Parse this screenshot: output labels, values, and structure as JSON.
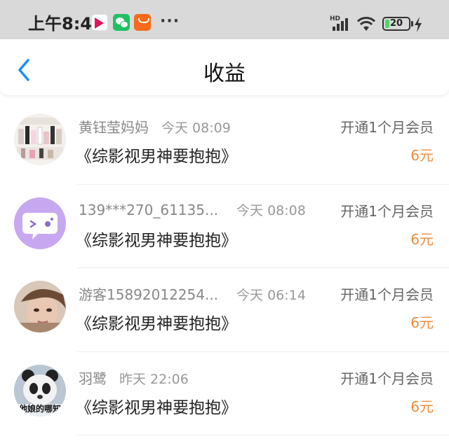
{
  "status_bar": {
    "time": "上午8:44",
    "more": "···",
    "network_label": "HD",
    "battery_percent": "20",
    "battery_level": 0.2,
    "icons": [
      "video-app-icon",
      "wechat-icon",
      "shopping-bag-icon",
      "signal-icon",
      "wifi-icon",
      "battery-icon",
      "charging-icon"
    ]
  },
  "header": {
    "title": "收益",
    "back_icon": "chevron-left-icon",
    "accent_color": "#1a8cff"
  },
  "earnings": [
    {
      "name": "黄钰莹妈妈",
      "time": "今天 08:09",
      "book": "《综影视男神要抱抱》",
      "action": "开通1个月会员",
      "amount": "6元",
      "avatar_text": "",
      "avatar_icon": "product-collage-avatar"
    },
    {
      "name": "139***270_61135...",
      "time": "今天 08:08",
      "book": "《综影视男神要抱抱》",
      "action": "开通1个月会员",
      "amount": "6元",
      "avatar_text": "",
      "avatar_icon": "chat-bubble-avatar"
    },
    {
      "name": "游客15892012254...",
      "time": "今天 06:14",
      "book": "《综影视男神要抱抱》",
      "action": "开通1个月会员",
      "amount": "6元",
      "avatar_text": "",
      "avatar_icon": "portrait-avatar"
    },
    {
      "name": "羽鹭",
      "time": "昨天 22:06",
      "book": "《综影视男神要抱抱》",
      "action": "开通1个月会员",
      "amount": "6元",
      "avatar_text": "他娘的哪知",
      "avatar_icon": "panda-avatar"
    }
  ],
  "colors": {
    "amount": "#f08b3a",
    "status_bar_bg": "#d9d9d9",
    "battery": "#4cd964"
  }
}
